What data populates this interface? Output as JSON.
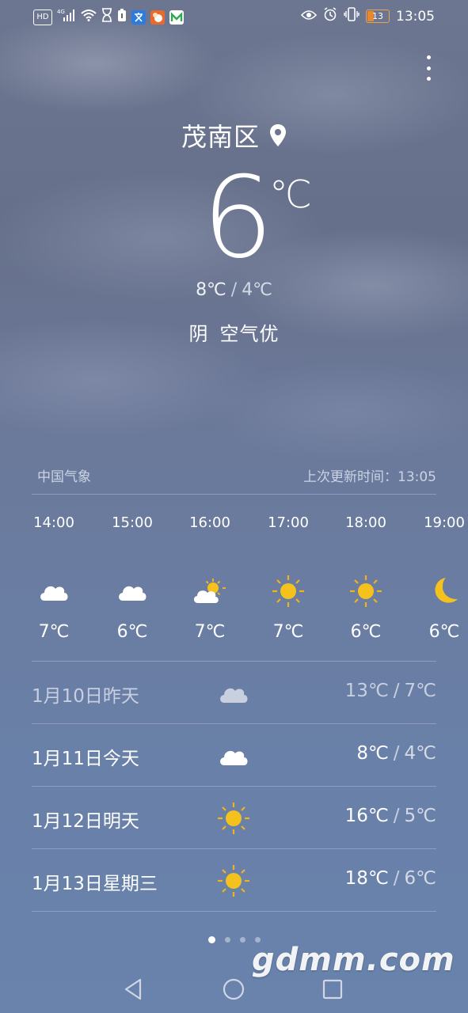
{
  "status_bar": {
    "left_icons": [
      "hd-icon",
      "4g-signal-icon",
      "wifi-icon",
      "hourglass-icon",
      "battery-saver-icon",
      "translate-app-icon",
      "squirrel-app-icon",
      "m-app-icon"
    ],
    "hd_label": "HD",
    "right_icons": [
      "eye-icon",
      "alarm-icon",
      "vibrate-icon"
    ],
    "battery_level": "13",
    "time": "13:05"
  },
  "location": {
    "city": "茂南区"
  },
  "current": {
    "temperature": "6",
    "unit": "℃",
    "high": "8℃",
    "separator": "/",
    "low": "4℃",
    "condition": "阴",
    "air_quality": "空气优"
  },
  "source": {
    "provider": "中国气象",
    "updated_label": "上次更新时间：13:05"
  },
  "hourly": [
    {
      "time": "14:00",
      "icon": "cloudy-icon",
      "temp": "7℃"
    },
    {
      "time": "15:00",
      "icon": "cloudy-icon",
      "temp": "6℃"
    },
    {
      "time": "16:00",
      "icon": "partly-sunny-icon",
      "temp": "7℃"
    },
    {
      "time": "17:00",
      "icon": "sunny-icon",
      "temp": "7℃"
    },
    {
      "time": "18:00",
      "icon": "sunny-icon",
      "temp": "6℃"
    },
    {
      "time": "19:00",
      "icon": "moon-icon",
      "temp": "6℃"
    }
  ],
  "daily": [
    {
      "date": "1月10日昨天",
      "icon": "cloudy-icon",
      "high": "13℃",
      "low": "7℃",
      "past": true
    },
    {
      "date": "1月11日今天",
      "icon": "cloudy-icon",
      "high": "8℃",
      "low": "4℃",
      "past": false
    },
    {
      "date": "1月12日明天",
      "icon": "sunny-icon",
      "high": "16℃",
      "low": "5℃",
      "past": false
    },
    {
      "date": "1月13日星期三",
      "icon": "sunny-icon",
      "high": "18℃",
      "low": "6℃",
      "past": false
    }
  ],
  "page_indicator": {
    "count": 4,
    "active": 0
  },
  "watermark": "gdmm.com",
  "colors": {
    "sun": "#f5c11d",
    "sun_ray": "#f2b21b",
    "cloud": "#ffffff",
    "battery_accent": "#e58a30"
  }
}
